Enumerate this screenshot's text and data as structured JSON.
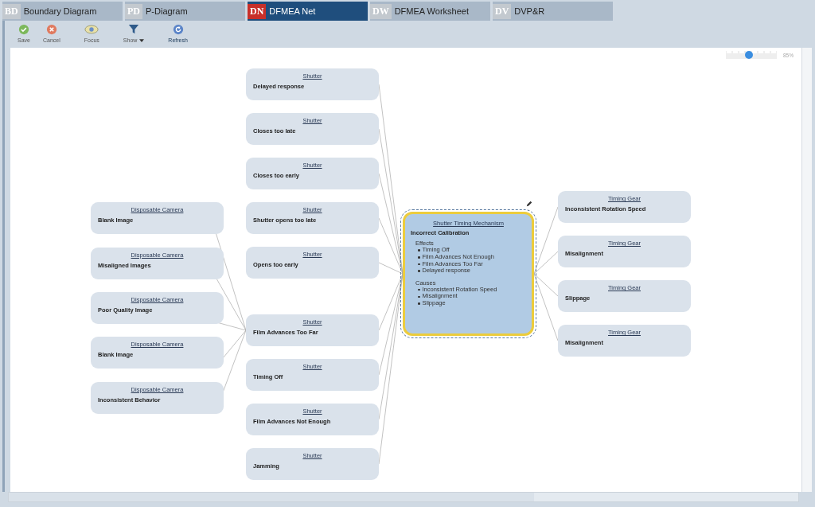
{
  "tabs": [
    {
      "badge": "BD",
      "label": "Boundary Diagram",
      "selected": false
    },
    {
      "badge": "PD",
      "label": "P-Diagram",
      "selected": false
    },
    {
      "badge": "DN",
      "label": "DFMEA Net",
      "selected": true
    },
    {
      "badge": "DW",
      "label": "DFMEA Worksheet",
      "selected": false
    },
    {
      "badge": "DV",
      "label": "DVP&R",
      "selected": false
    }
  ],
  "toolbar": [
    {
      "kind": "save",
      "label": "Save"
    },
    {
      "kind": "cancel",
      "label": "Cancel"
    },
    {
      "kind": "focus",
      "label": "Focus"
    },
    {
      "kind": "show",
      "label": "Show"
    },
    {
      "kind": "refresh",
      "label": "Refresh"
    }
  ],
  "zoom": {
    "level": 0.45,
    "reading": "85%"
  },
  "left_column": [
    {
      "component": "Disposable Camera",
      "name": "Blank Image"
    },
    {
      "component": "Disposable Camera",
      "name": "Misaligned Images"
    },
    {
      "component": "Disposable Camera",
      "name": "Poor Quality Image"
    },
    {
      "component": "Disposable Camera",
      "name": "Blank Image"
    },
    {
      "component": "Disposable Camera",
      "name": "Inconsistent Behavior"
    }
  ],
  "middle_column": [
    {
      "component": "Shutter",
      "name": "Delayed response",
      "linked_left": false
    },
    {
      "component": "Shutter",
      "name": "Closes too late",
      "linked_left": false
    },
    {
      "component": "Shutter",
      "name": "Closes too early",
      "linked_left": false
    },
    {
      "component": "Shutter",
      "name": "Shutter opens too late",
      "linked_left": false
    },
    {
      "component": "Shutter",
      "name": "Opens too early",
      "linked_left": false
    },
    {
      "component": "Shutter",
      "name": "Film Advances Too Far",
      "linked_left": true
    },
    {
      "component": "Shutter",
      "name": "Timing Off",
      "linked_left": false
    },
    {
      "component": "Shutter",
      "name": "Film Advances Not Enough",
      "linked_left": false
    },
    {
      "component": "Shutter",
      "name": "Jamming",
      "linked_left": false
    }
  ],
  "focus": {
    "component": "Shutter Timing Mechanism",
    "name": "Incorrect Calibration",
    "selected": true,
    "effects_heading": "Effects",
    "effects": [
      "Timing Off",
      "Film Advances Not Enough",
      "Film Advances Too Far",
      "Delayed response"
    ],
    "causes_heading": "Causes",
    "causes": [
      "Inconsistent Rotation Speed",
      "Misalignment",
      "Slippage"
    ]
  },
  "right_column": [
    {
      "component": "Timing Gear",
      "name": "Inconsistent Rotation Speed"
    },
    {
      "component": "Timing Gear",
      "name": "Misalignment"
    },
    {
      "component": "Timing Gear",
      "name": "Slippage"
    },
    {
      "component": "Timing Gear",
      "name": "Misalignment"
    }
  ]
}
